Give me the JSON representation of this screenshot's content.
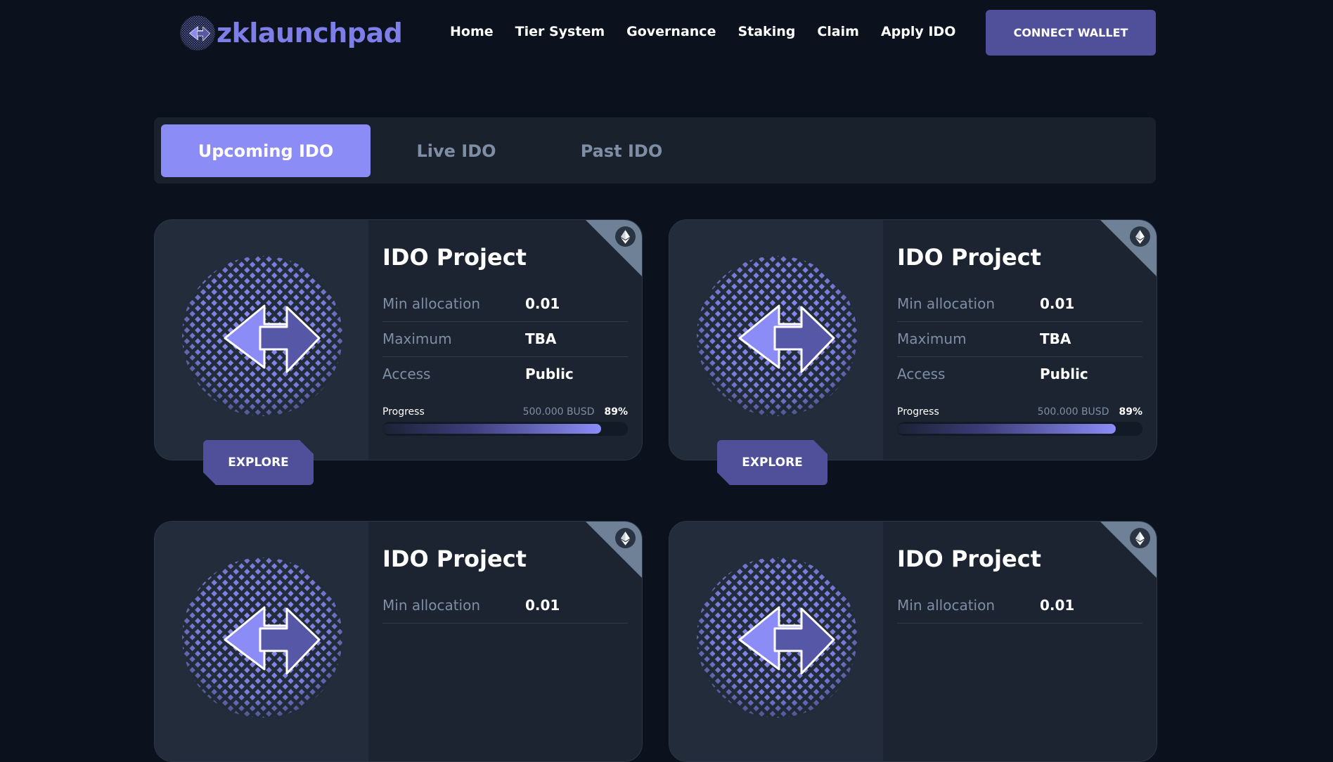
{
  "header": {
    "logo_text": "zklaunchpad",
    "nav": [
      "Home",
      "Tier System",
      "Governance",
      "Staking",
      "Claim",
      "Apply IDO"
    ],
    "connect_wallet": "CONNECT WALLET"
  },
  "tabs": [
    {
      "label": "Upcoming IDO",
      "active": true
    },
    {
      "label": "Live IDO",
      "active": false
    },
    {
      "label": "Past IDO",
      "active": false
    }
  ],
  "cards": [
    {
      "title": "IDO Project",
      "network_icon": "ethereum-icon",
      "rows": [
        {
          "label": "Min allocation",
          "value": "0.01"
        },
        {
          "label": "Maximum",
          "value": "TBA"
        },
        {
          "label": "Access",
          "value": "Public"
        }
      ],
      "progress_label": "Progress",
      "progress_amount": "500.000 BUSD",
      "progress_pct": "89%",
      "progress_value": 0.89,
      "explore": "EXPLORE"
    },
    {
      "title": "IDO Project",
      "network_icon": "ethereum-icon",
      "rows": [
        {
          "label": "Min allocation",
          "value": "0.01"
        },
        {
          "label": "Maximum",
          "value": "TBA"
        },
        {
          "label": "Access",
          "value": "Public"
        }
      ],
      "progress_label": "Progress",
      "progress_amount": "500.000 BUSD",
      "progress_pct": "89%",
      "progress_value": 0.89,
      "explore": "EXPLORE"
    },
    {
      "title": "IDO Project",
      "network_icon": "ethereum-icon",
      "rows": [
        {
          "label": "Min allocation",
          "value": "0.01"
        }
      ]
    },
    {
      "title": "IDO Project",
      "network_icon": "ethereum-icon",
      "rows": [
        {
          "label": "Min allocation",
          "value": "0.01"
        }
      ]
    }
  ],
  "colors": {
    "background": "#0b121d",
    "accent": "#8c8cf7",
    "button": "#4f4f9a",
    "muted_text": "#7f8ea4"
  }
}
